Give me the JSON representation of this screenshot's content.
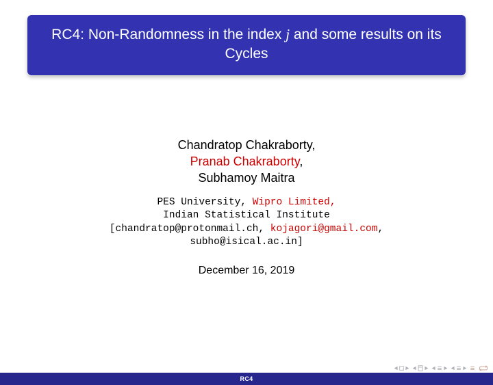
{
  "title": {
    "prefix": "RC4: Non-Randomness in the index ",
    "italic": "j",
    "suffix": " and some results on its Cycles"
  },
  "authors": {
    "a1": "Chandratop Chakraborty,",
    "a2_highlight": "Pranab Chakraborty",
    "a2_suffix": ",",
    "a3": "Subhamoy Maitra"
  },
  "affiliation": {
    "line1_a": "PES University, ",
    "line1_b_highlight": "Wipro Limited,",
    "line2": "Indian Statistical Institute",
    "line3_a": "[chandratop@protonmail.ch, ",
    "line3_b_highlight": "kojagori@gmail.com",
    "line3_c": ",",
    "line4": "subho@isical.ac.in]"
  },
  "date": "December 16, 2019",
  "footer": {
    "short_title": "RC4"
  },
  "nav": {
    "first": "first-slide",
    "prev": "previous-slide",
    "next": "next-slide",
    "last": "last-slide",
    "back": "go-back",
    "forward": "go-forward",
    "mode": "toggle-mode",
    "loop": "loop"
  }
}
